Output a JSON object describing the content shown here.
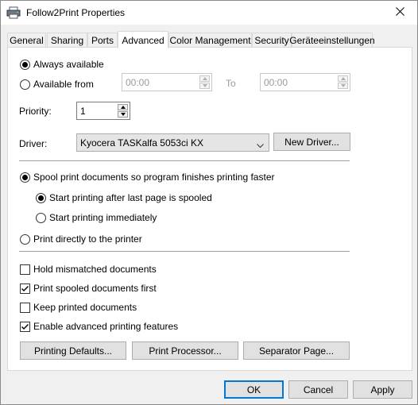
{
  "window": {
    "title": "Follow2Print Properties",
    "close_icon": "close-icon",
    "printer_icon": "printer-icon"
  },
  "tabs": [
    {
      "label": "General"
    },
    {
      "label": "Sharing"
    },
    {
      "label": "Ports"
    },
    {
      "label": "Advanced",
      "active": true
    },
    {
      "label": "Color Management"
    },
    {
      "label": "Security"
    },
    {
      "label": "Geräteeinstellungen"
    }
  ],
  "availability": {
    "always_label": "Always available",
    "from_label": "Available from",
    "from_value": "00:00",
    "to_label": "To",
    "to_value": "00:00",
    "selected": "always"
  },
  "priority": {
    "label": "Priority:",
    "value": "1"
  },
  "driver": {
    "label": "Driver:",
    "value": "Kyocera TASKalfa 5053ci KX",
    "new_driver_label": "New Driver..."
  },
  "spooling": {
    "spool_label": "Spool print documents so program finishes printing faster",
    "after_last_label": "Start printing after last page is spooled",
    "immediately_label": "Start printing immediately",
    "direct_label": "Print directly to the printer",
    "selected": "spool",
    "spool_sub_selected": "after_last"
  },
  "options": [
    {
      "label": "Hold mismatched documents",
      "checked": false
    },
    {
      "label": "Print spooled documents first",
      "checked": true
    },
    {
      "label": "Keep printed documents",
      "checked": false
    },
    {
      "label": "Enable advanced printing features",
      "checked": true
    }
  ],
  "buttons": {
    "printing_defaults": "Printing Defaults...",
    "print_processor": "Print Processor...",
    "separator_page": "Separator Page...",
    "ok": "OK",
    "cancel": "Cancel",
    "apply": "Apply"
  },
  "colors": {
    "accent": "#0078d7",
    "panel": "#ffffff",
    "window": "#f0f0f0"
  }
}
